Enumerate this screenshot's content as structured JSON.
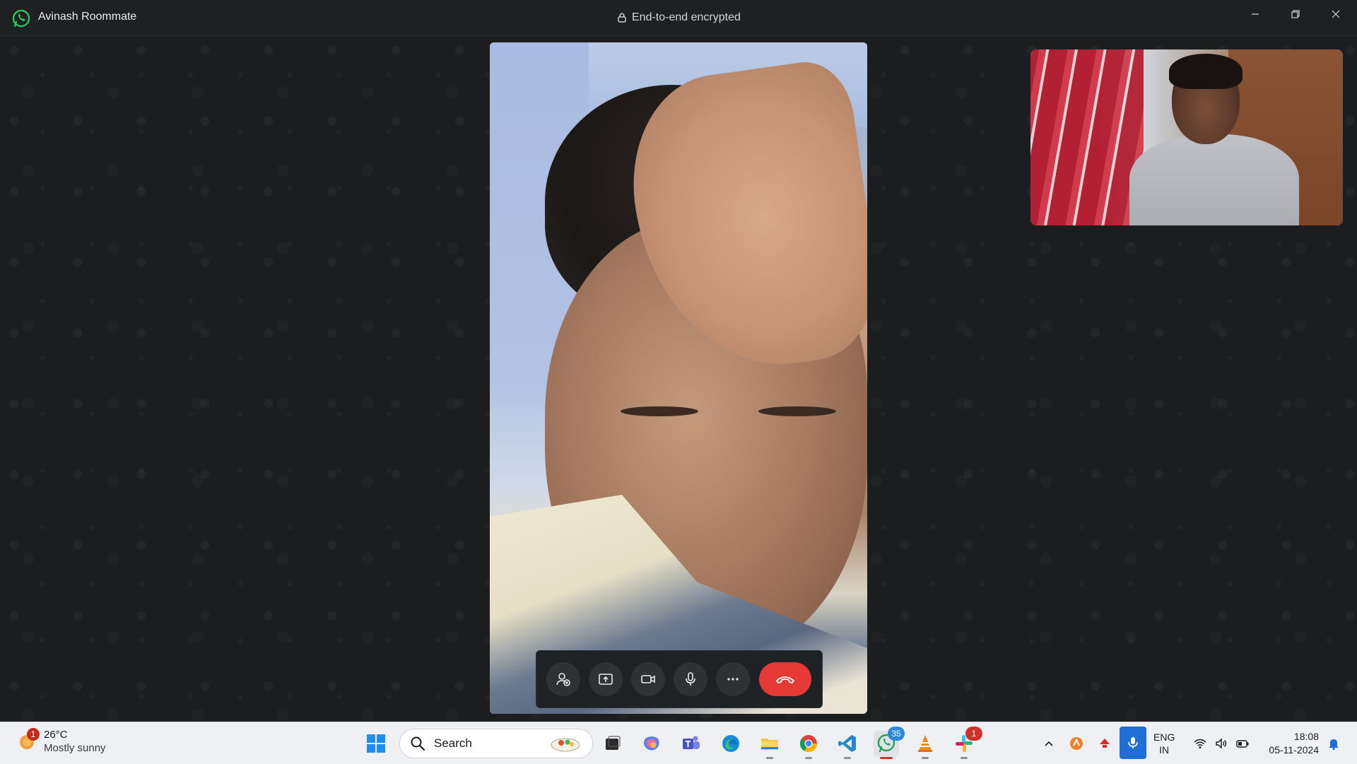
{
  "window": {
    "title": "Avinash Roommate",
    "encryption_label": "End-to-end encrypted",
    "icons": {
      "app": "whatsapp-icon",
      "lock": "lock-icon",
      "minimize": "minimize-icon",
      "maximize": "restore-icon",
      "close": "close-icon"
    }
  },
  "call_controls": {
    "buttons": [
      {
        "name": "add-participant",
        "icon": "person-add-icon"
      },
      {
        "name": "share-screen",
        "icon": "screen-share-icon"
      },
      {
        "name": "camera",
        "icon": "video-camera-icon"
      },
      {
        "name": "microphone",
        "icon": "microphone-icon"
      },
      {
        "name": "more-options",
        "icon": "ellipsis-icon"
      },
      {
        "name": "end-call",
        "icon": "end-call-icon",
        "color": "#e53935"
      }
    ]
  },
  "taskbar": {
    "weather": {
      "temperature": "26°C",
      "condition": "Mostly sunny",
      "badge": "1"
    },
    "search_placeholder": "Search",
    "apps": [
      {
        "name": "start",
        "icon": "windows-icon"
      },
      {
        "name": "task-view",
        "icon": "task-view-icon"
      },
      {
        "name": "copilot",
        "icon": "copilot-icon"
      },
      {
        "name": "teams",
        "icon": "teams-icon"
      },
      {
        "name": "edge",
        "icon": "edge-icon"
      },
      {
        "name": "file-explorer",
        "icon": "folder-icon"
      },
      {
        "name": "chrome",
        "icon": "chrome-icon"
      },
      {
        "name": "vscode",
        "icon": "vscode-icon"
      },
      {
        "name": "whatsapp",
        "icon": "whatsapp-icon",
        "badge": "35"
      },
      {
        "name": "vlc",
        "icon": "vlc-icon"
      },
      {
        "name": "slack",
        "icon": "slack-icon",
        "badge": "1"
      }
    ],
    "tray": {
      "language_line1": "ENG",
      "language_line2": "IN",
      "time": "18:08",
      "date": "05-11-2024"
    }
  },
  "colors": {
    "accent_whatsapp": "#25d366",
    "end_call_red": "#e53935",
    "taskbar_bg": "#eef0f3"
  }
}
